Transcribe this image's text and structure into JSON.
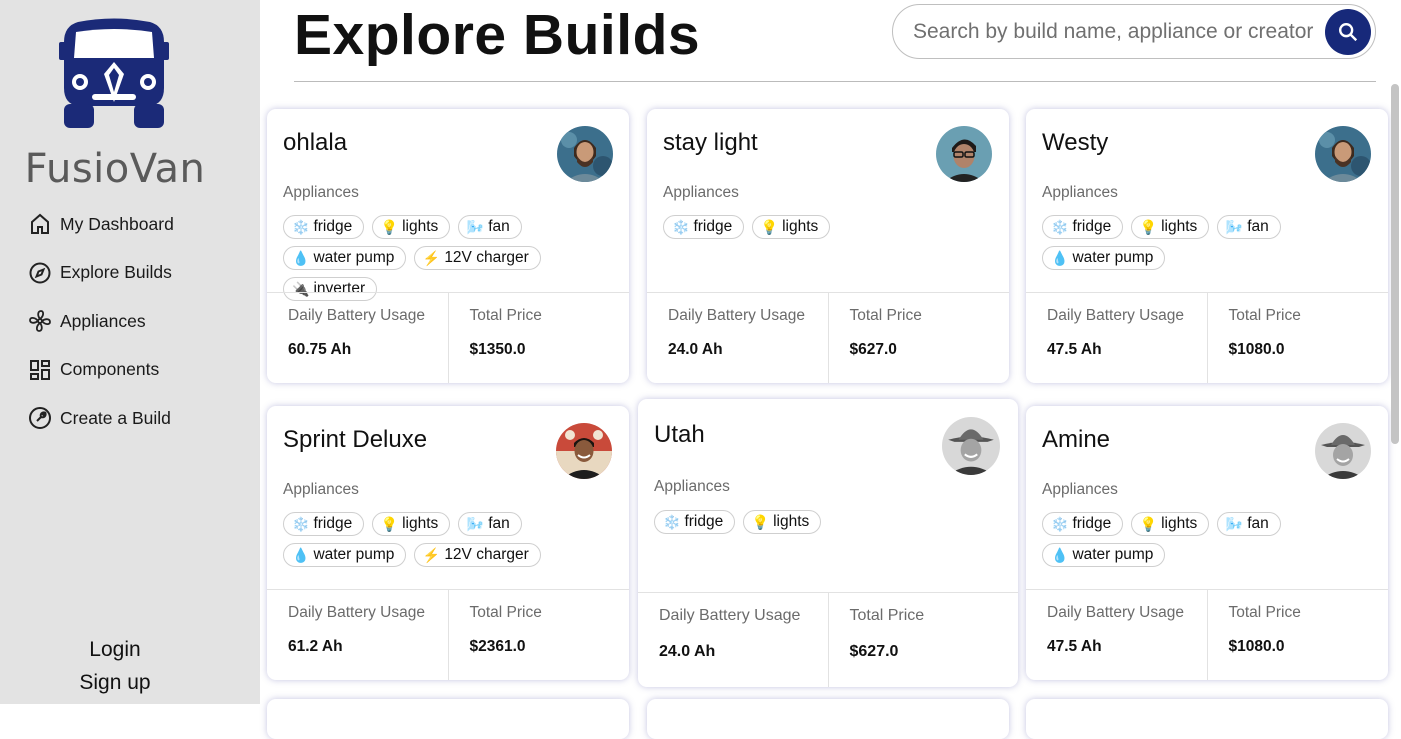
{
  "brand": {
    "name": "FusioVan",
    "logo_icon": "van-logo-icon",
    "color": "#1b2a78"
  },
  "nav": [
    {
      "label": "My Dashboard",
      "icon": "home-icon"
    },
    {
      "label": "Explore Builds",
      "icon": "compass-icon"
    },
    {
      "label": "Appliances",
      "icon": "fan-icon"
    },
    {
      "label": "Components",
      "icon": "grid-icon"
    },
    {
      "label": "Create a Build",
      "icon": "wrench-icon"
    }
  ],
  "auth": {
    "login": "Login",
    "signup": "Sign up"
  },
  "page": {
    "title": "Explore Builds"
  },
  "search": {
    "placeholder": "Search by build name, appliance or creator",
    "icon": "search-icon",
    "button_color": "#17297a"
  },
  "labels": {
    "appliances": "Appliances",
    "battery": "Daily Battery Usage",
    "price": "Total Price"
  },
  "builds": [
    {
      "name": "ohlala",
      "avatar": "bearded-man",
      "appliances": [
        {
          "icon": "❄️",
          "label": "fridge"
        },
        {
          "icon": "💡",
          "label": "lights"
        },
        {
          "icon": "🌬️",
          "label": "fan"
        },
        {
          "icon": "💧",
          "label": "water pump"
        },
        {
          "icon": "⚡",
          "label": "12V charger"
        },
        {
          "icon": "🔌",
          "label": "inverter"
        }
      ],
      "battery": "60.75 Ah",
      "price": "$1350.0"
    },
    {
      "name": "stay light",
      "avatar": "man-glasses",
      "appliances": [
        {
          "icon": "❄️",
          "label": "fridge"
        },
        {
          "icon": "💡",
          "label": "lights"
        }
      ],
      "battery": "24.0 Ah",
      "price": "$627.0"
    },
    {
      "name": "Westy",
      "avatar": "bearded-man",
      "appliances": [
        {
          "icon": "❄️",
          "label": "fridge"
        },
        {
          "icon": "💡",
          "label": "lights"
        },
        {
          "icon": "🌬️",
          "label": "fan"
        },
        {
          "icon": "💧",
          "label": "water pump"
        }
      ],
      "battery": "47.5 Ah",
      "price": "$1080.0"
    },
    {
      "name": "Sprint Deluxe",
      "avatar": "smiling-man-red",
      "appliances": [
        {
          "icon": "❄️",
          "label": "fridge"
        },
        {
          "icon": "💡",
          "label": "lights"
        },
        {
          "icon": "🌬️",
          "label": "fan"
        },
        {
          "icon": "💧",
          "label": "water pump"
        },
        {
          "icon": "⚡",
          "label": "12V charger"
        }
      ],
      "battery": "61.2 Ah",
      "price": "$2361.0"
    },
    {
      "name": "Utah",
      "avatar": "man-hat",
      "appliances": [
        {
          "icon": "❄️",
          "label": "fridge"
        },
        {
          "icon": "💡",
          "label": "lights"
        }
      ],
      "battery": "24.0 Ah",
      "price": "$627.0"
    },
    {
      "name": "Amine",
      "avatar": "man-hat",
      "appliances": [
        {
          "icon": "❄️",
          "label": "fridge"
        },
        {
          "icon": "💡",
          "label": "lights"
        },
        {
          "icon": "🌬️",
          "label": "fan"
        },
        {
          "icon": "💧",
          "label": "water pump"
        }
      ],
      "battery": "47.5 Ah",
      "price": "$1080.0"
    }
  ]
}
